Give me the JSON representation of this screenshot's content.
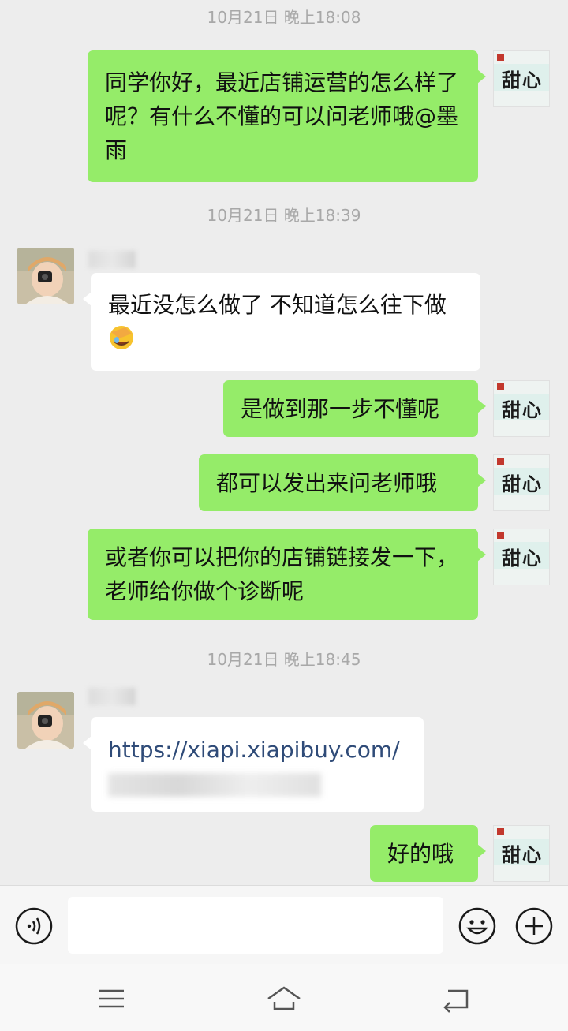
{
  "chat": {
    "timestamps": [
      "10月21日 晚上18:08",
      "10月21日 晚上18:39",
      "10月21日 晚上18:45"
    ],
    "messages": [
      {
        "from": "me",
        "text": "同学你好，最近店铺运营的怎么样了呢？有什么不懂的可以问老师哦@墨雨"
      },
      {
        "from": "them",
        "text": "最近没怎么做了 不知道怎么往下做",
        "emoji": "facepalm-emoji"
      },
      {
        "from": "me",
        "text": "是做到那一步不懂呢"
      },
      {
        "from": "me",
        "text": "都可以发出来问老师哦"
      },
      {
        "from": "me",
        "text": "或者你可以把你的店铺链接发一下，老师给你做个诊断呢"
      },
      {
        "from": "them",
        "text": "https://xiapi.xiapibuy.com/"
      },
      {
        "from": "me",
        "text": "好的哦"
      }
    ]
  },
  "my_avatar": {
    "calligraphy": "甜心"
  },
  "input_bar": {
    "left_icon": "voice-icon",
    "right_icons": [
      "emoji-icon",
      "plus-icon"
    ]
  },
  "nav_bar": {
    "icons": [
      "menu-icon",
      "home-icon",
      "back-icon"
    ]
  },
  "colors": {
    "outgoing_bubble": "#95ec69",
    "incoming_bubble": "#ffffff",
    "background": "#ededed"
  }
}
